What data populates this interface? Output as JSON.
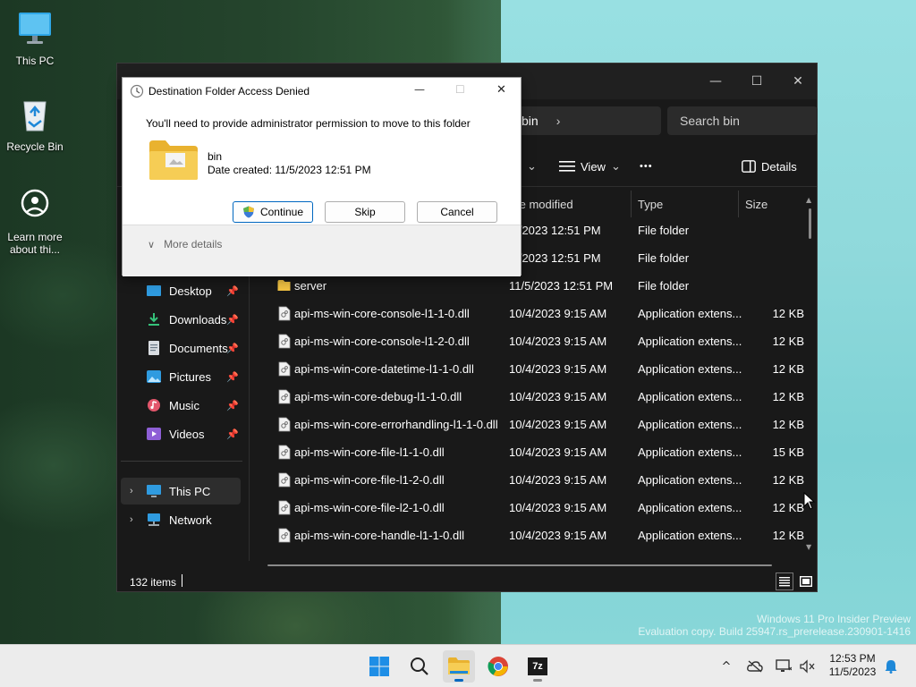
{
  "desktop": {
    "icons": [
      {
        "label": "This PC",
        "icon": "monitor-icon"
      },
      {
        "label": "Recycle Bin",
        "icon": "recycle-bin-icon"
      },
      {
        "label_line1": "Learn more",
        "label_line2": "about thi...",
        "icon": "learn-more-icon"
      }
    ],
    "watermark": {
      "line1": "Windows 11 Pro Insider Preview",
      "line2": "Evaluation copy. Build 25947.rs_prerelease.230901-1416"
    }
  },
  "explorer": {
    "controls": {
      "minimize": "—",
      "maximize": "☐",
      "close": "✕"
    },
    "breadcrumb_current": "bin",
    "breadcrumb_chevron": "›",
    "search_placeholder": "Search bin",
    "toolbar": {
      "sort_chevron": "⌄",
      "view_label": "View",
      "view_chevron": "⌄",
      "more": "•••",
      "details_label": "Details"
    },
    "nav": [
      {
        "label": "Desktop",
        "pinned": true
      },
      {
        "label": "Downloads",
        "pinned": true
      },
      {
        "label": "Documents",
        "pinned": true
      },
      {
        "label": "Pictures",
        "pinned": true
      },
      {
        "label": "Music",
        "pinned": true
      },
      {
        "label": "Videos",
        "pinned": true
      },
      {
        "label": "This PC",
        "expandable": true,
        "selected": true
      },
      {
        "label": "Network",
        "expandable": true
      }
    ],
    "columns": {
      "date": "te modified",
      "type": "Type",
      "size": "Size"
    },
    "rows": [
      {
        "name": "",
        "date": "/5/2023 12:51 PM",
        "type": "File folder",
        "size": "",
        "kind": "folder"
      },
      {
        "name": "",
        "date": "/5/2023 12:51 PM",
        "type": "File folder",
        "size": "",
        "kind": "folder"
      },
      {
        "name": "server",
        "date": "11/5/2023 12:51 PM",
        "type": "File folder",
        "size": "",
        "kind": "folder"
      },
      {
        "name": "api-ms-win-core-console-l1-1-0.dll",
        "date": "10/4/2023 9:15 AM",
        "type": "Application extens...",
        "size": "12 KB",
        "kind": "file"
      },
      {
        "name": "api-ms-win-core-console-l1-2-0.dll",
        "date": "10/4/2023 9:15 AM",
        "type": "Application extens...",
        "size": "12 KB",
        "kind": "file"
      },
      {
        "name": "api-ms-win-core-datetime-l1-1-0.dll",
        "date": "10/4/2023 9:15 AM",
        "type": "Application extens...",
        "size": "12 KB",
        "kind": "file"
      },
      {
        "name": "api-ms-win-core-debug-l1-1-0.dll",
        "date": "10/4/2023 9:15 AM",
        "type": "Application extens...",
        "size": "12 KB",
        "kind": "file"
      },
      {
        "name": "api-ms-win-core-errorhandling-l1-1-0.dll",
        "date": "10/4/2023 9:15 AM",
        "type": "Application extens...",
        "size": "12 KB",
        "kind": "file"
      },
      {
        "name": "api-ms-win-core-file-l1-1-0.dll",
        "date": "10/4/2023 9:15 AM",
        "type": "Application extens...",
        "size": "15 KB",
        "kind": "file"
      },
      {
        "name": "api-ms-win-core-file-l1-2-0.dll",
        "date": "10/4/2023 9:15 AM",
        "type": "Application extens...",
        "size": "12 KB",
        "kind": "file"
      },
      {
        "name": "api-ms-win-core-file-l2-1-0.dll",
        "date": "10/4/2023 9:15 AM",
        "type": "Application extens...",
        "size": "12 KB",
        "kind": "file"
      },
      {
        "name": "api-ms-win-core-handle-l1-1-0.dll",
        "date": "10/4/2023 9:15 AM",
        "type": "Application extens...",
        "size": "12 KB",
        "kind": "file"
      }
    ],
    "status": {
      "count": "132 items"
    }
  },
  "dialog": {
    "title": "Destination Folder Access Denied",
    "message": "You'll need to provide administrator permission to move to this folder",
    "folder_name": "bin",
    "date_created": "Date created: 11/5/2023 12:51 PM",
    "buttons": {
      "continue": "Continue",
      "skip": "Skip",
      "cancel": "Cancel"
    },
    "more_details": "More details",
    "controls": {
      "minimize": "—",
      "maximize": "☐",
      "close": "✕"
    }
  },
  "taskbar": {
    "apps": [
      "start-icon",
      "search-icon",
      "file-explorer-icon",
      "chrome-icon",
      "7zip-icon"
    ],
    "sevenzip_label": "7z",
    "time": "12:53 PM",
    "date": "11/5/2023",
    "tray_chevron": "^"
  },
  "colors": {
    "accent": "#0067c0",
    "explorer_bg": "#191919",
    "folder_yellow": "#f4c443"
  }
}
